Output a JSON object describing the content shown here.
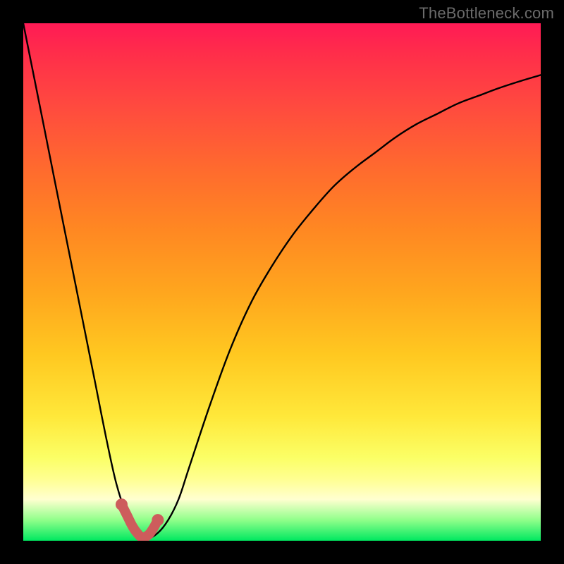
{
  "watermark": "TheBottleneck.com",
  "colors": {
    "background": "#000000",
    "curve": "#000000",
    "marker": "#cd5c5c"
  },
  "chart_data": {
    "type": "line",
    "title": "",
    "xlabel": "",
    "ylabel": "",
    "xlim": [
      0,
      100
    ],
    "ylim": [
      0,
      100
    ],
    "grid": false,
    "legend": false,
    "x": [
      0,
      2,
      4,
      6,
      8,
      10,
      12,
      14,
      16,
      18,
      20,
      22,
      24,
      26,
      28,
      30,
      32,
      36,
      40,
      44,
      48,
      52,
      56,
      60,
      64,
      68,
      72,
      76,
      80,
      84,
      88,
      92,
      96,
      100
    ],
    "y": [
      100,
      90,
      80,
      70,
      60,
      50,
      40,
      30,
      20,
      11,
      5,
      1.5,
      0.5,
      1.5,
      4,
      8,
      14,
      26,
      37,
      46,
      53,
      59,
      64,
      68.5,
      72,
      75,
      78,
      80.5,
      82.5,
      84.5,
      86,
      87.5,
      88.8,
      90
    ],
    "marker_region": {
      "x": [
        19,
        20,
        21,
        22,
        23,
        24,
        25,
        26
      ],
      "y": [
        7,
        5,
        3,
        1.5,
        0.7,
        1.0,
        2.2,
        4
      ]
    },
    "gradient_stops": [
      {
        "pos": 0.0,
        "color": "#ff1a55"
      },
      {
        "pos": 0.16,
        "color": "#ff4a3f"
      },
      {
        "pos": 0.4,
        "color": "#ff8822"
      },
      {
        "pos": 0.64,
        "color": "#ffc820"
      },
      {
        "pos": 0.84,
        "color": "#fbff66"
      },
      {
        "pos": 0.92,
        "color": "#ffffd0"
      },
      {
        "pos": 1.0,
        "color": "#00e860"
      }
    ]
  }
}
